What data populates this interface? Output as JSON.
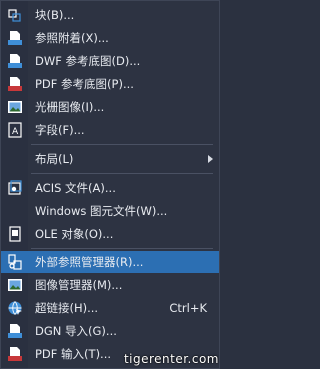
{
  "menu": {
    "items": [
      {
        "label": "块(B)...",
        "icon": "block-icon"
      },
      {
        "label": "参照附着(X)...",
        "icon": "dwg-attach-icon"
      },
      {
        "label": "DWF 参考底图(D)...",
        "icon": "dwf-underlay-icon"
      },
      {
        "label": "PDF 参考底图(P)...",
        "icon": "pdf-underlay-icon"
      },
      {
        "label": "光栅图像(I)...",
        "icon": "raster-image-icon"
      },
      {
        "label": "字段(F)...",
        "icon": "field-icon"
      },
      {
        "label": "布局(L)",
        "submenu": true
      },
      {
        "label": "ACIS 文件(A)...",
        "icon": "acis-icon"
      },
      {
        "label": "Windows 图元文件(W)...",
        "icon": ""
      },
      {
        "label": "OLE 对象(O)...",
        "icon": "ole-object-icon"
      },
      {
        "label": "外部参照管理器(R)...",
        "icon": "xref-manager-icon",
        "highlighted": true
      },
      {
        "label": "图像管理器(M)...",
        "icon": "image-manager-icon"
      },
      {
        "label": "超链接(H)...",
        "icon": "hyperlink-icon",
        "shortcut": "Ctrl+K"
      },
      {
        "label": "DGN 导入(G)...",
        "icon": "dgn-import-icon"
      },
      {
        "label": "PDF 输入(T)...",
        "icon": "pdf-import-icon"
      }
    ]
  },
  "watermark": "tigerenter.com",
  "colors": {
    "menu_bg": "#2d3342",
    "highlight": "#2c6fb3",
    "text": "#e8ebf0",
    "icon_blue": "#3f8fd8"
  }
}
